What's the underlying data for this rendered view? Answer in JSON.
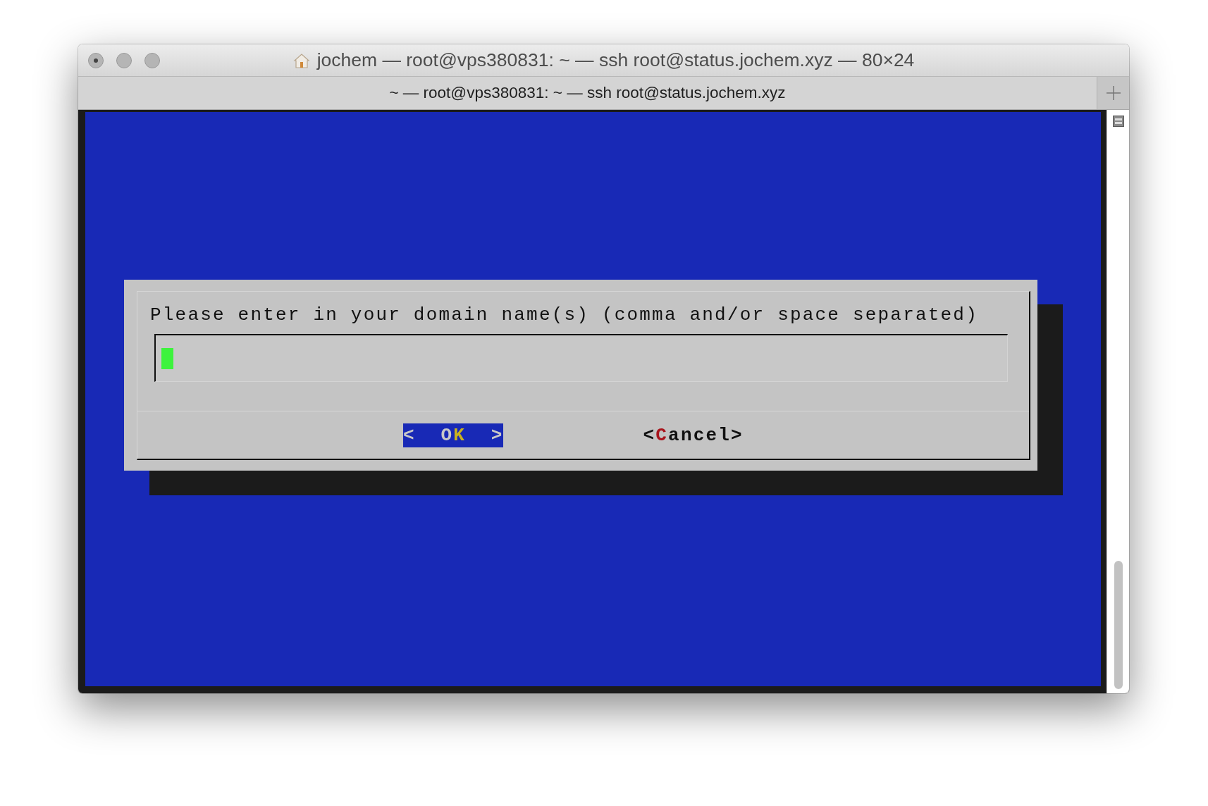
{
  "window": {
    "title": "jochem — root@vps380831: ~ — ssh root@status.jochem.xyz — 80×24"
  },
  "tab": {
    "label": "~ — root@vps380831: ~ — ssh root@status.jochem.xyz"
  },
  "dialog": {
    "prompt": "Please enter in your domain name(s) (comma and/or space separated)",
    "buttons": [
      {
        "selected": true,
        "parts": [
          {
            "text": "<  O",
            "hotkey": false
          },
          {
            "text": "K",
            "hotkey": true
          },
          {
            "text": "  >",
            "hotkey": false
          }
        ]
      },
      {
        "selected": false,
        "parts": [
          {
            "text": "<",
            "hotkey": false
          },
          {
            "text": "C",
            "hotkey": true
          },
          {
            "text": "ancel>",
            "hotkey": false
          }
        ]
      }
    ]
  }
}
